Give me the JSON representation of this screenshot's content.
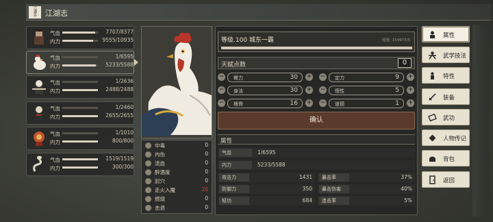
{
  "header": {
    "title": "江湖志",
    "book_glyph": "江湖志"
  },
  "party": [
    {
      "hp_label": "气血",
      "mp_label": "内力",
      "hp": "7707/8377",
      "mp": "9555/10935",
      "hp_frac": 0.92,
      "mp_frac": 0.87
    },
    {
      "hp_label": "气血",
      "mp_label": "内力",
      "hp": "1/6595",
      "mp": "5233/5588",
      "hp_frac": 0.0,
      "mp_frac": 0.94
    },
    {
      "hp_label": "气血",
      "mp_label": "内力",
      "hp": "1/2636",
      "mp": "2488/2488",
      "hp_frac": 0.0,
      "mp_frac": 1.0
    },
    {
      "hp_label": "气血",
      "mp_label": "内力",
      "hp": "1/2460",
      "mp": "2655/2655",
      "hp_frac": 0.0,
      "mp_frac": 1.0
    },
    {
      "hp_label": "气血",
      "mp_label": "内力",
      "hp": "1/1010",
      "mp": "800/800",
      "hp_frac": 0.0,
      "mp_frac": 1.0
    },
    {
      "hp_label": "气血",
      "mp_label": "内力",
      "hp": "1519/1519",
      "mp": "300/300",
      "hp_frac": 1.0,
      "mp_frac": 1.0
    }
  ],
  "status": [
    {
      "name": "中毒",
      "value": "0",
      "icon": "poison-icon"
    },
    {
      "name": "内伤",
      "value": "0",
      "icon": "heart-icon"
    },
    {
      "name": "流血",
      "value": "0",
      "icon": "blood-icon"
    },
    {
      "name": "醉酒度",
      "value": "0",
      "icon": "wine-icon"
    },
    {
      "name": "封穴",
      "value": "0",
      "icon": "seal-icon"
    },
    {
      "name": "走火入魔",
      "value": "20",
      "icon": "spiral-icon",
      "highlight": true
    },
    {
      "name": "燃烧",
      "value": "0",
      "icon": "fire-icon"
    },
    {
      "name": "击退",
      "value": "0",
      "icon": "knockback-icon"
    }
  ],
  "rank": {
    "name": "等级.100 城东一霸",
    "xp": "经验: 154973/0",
    "progress": 1.0
  },
  "talent": {
    "label": "天赋点数",
    "points": "0"
  },
  "attributes": [
    {
      "name": "臂力",
      "value": "30"
    },
    {
      "name": "定力",
      "value": "9"
    },
    {
      "name": "身法",
      "value": "30"
    },
    {
      "name": "悟性",
      "value": "5"
    },
    {
      "name": "根骨",
      "value": "16"
    },
    {
      "name": "道德",
      "value": "1"
    }
  ],
  "confirm_label": "确认",
  "props_section": "属性",
  "vitals": [
    {
      "label": "气血",
      "value": "1/6595"
    },
    {
      "label": "内力",
      "value": "5233/5588"
    }
  ],
  "combat": [
    {
      "label": "攻击力",
      "value": "1431"
    },
    {
      "label": "暴击率",
      "value": "37%"
    },
    {
      "label": "防御力",
      "value": "350"
    },
    {
      "label": "暴击伤害",
      "value": "40%"
    },
    {
      "label": "轻功",
      "value": "684"
    },
    {
      "label": "连击率",
      "value": "5%"
    }
  ],
  "menu": [
    {
      "label": "属性",
      "icon": "person-icon"
    },
    {
      "label": "武学技法",
      "icon": "martial-icon"
    },
    {
      "label": "特性",
      "icon": "trait-icon"
    },
    {
      "label": "装备",
      "icon": "sword-icon"
    },
    {
      "label": "武功",
      "icon": "scroll-icon"
    },
    {
      "label": "人物传记",
      "icon": "biography-icon"
    },
    {
      "label": "背包",
      "icon": "bag-icon"
    },
    {
      "label": "返回",
      "icon": "door-icon"
    }
  ]
}
